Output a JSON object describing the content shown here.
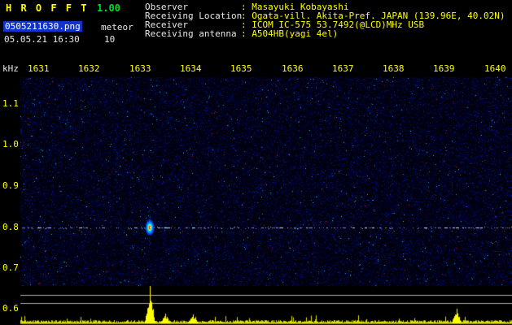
{
  "header": {
    "app_name": "H R O F F T",
    "version": "1.00",
    "filename": "0505211630.png",
    "mode": "meteor",
    "timestamp": "05.05.21 16:30",
    "count": "10",
    "info": [
      {
        "label": "Observer",
        "value": ": Masayuki Kobayashi"
      },
      {
        "label": "Receiving Location",
        "value": ": Ogata-vill. Akita-Pref. JAPAN (139.96E, 40.02N)"
      },
      {
        "label": "Receiver",
        "value": ": ICOM IC-575 53.7492(@LCD)MHz USB"
      },
      {
        "label": "Receiving antenna",
        "value": ": A504HB(yagi 4el)"
      }
    ]
  },
  "chart_data": {
    "type": "heatmap",
    "title": "",
    "ylabel": "kHz",
    "x_ticks": [
      "1631",
      "1632",
      "1633",
      "1634",
      "1635",
      "1636",
      "1637",
      "1638",
      "1639",
      "1640"
    ],
    "y_ticks": [
      "1.1",
      "1.0",
      "0.9",
      "0.8",
      "0.7",
      "0.6"
    ],
    "x_range_hhmm": [
      1631,
      1640
    ],
    "y_range_khz": [
      0.6,
      1.15
    ],
    "carrier_freq_khz": 0.8,
    "echoes": [
      {
        "time_hhmm": 1633.2,
        "freq_khz": 0.8,
        "strength": "strong"
      }
    ],
    "signal_peaks": [
      {
        "time_hhmm": 1633.2,
        "level": 46
      },
      {
        "time_hhmm": 1633.5,
        "level": 12
      },
      {
        "time_hhmm": 1634.05,
        "level": 11
      },
      {
        "time_hhmm": 1639.25,
        "level": 18
      }
    ],
    "colors": {
      "background": "#000008",
      "noise_blue": "#0000aa",
      "tick_label": "#ffff00",
      "signal_trace": "#ffff00",
      "echo_core": "#ff2200",
      "echo_halo": "#0066ff",
      "level_lines": "#aaaaaa"
    }
  }
}
